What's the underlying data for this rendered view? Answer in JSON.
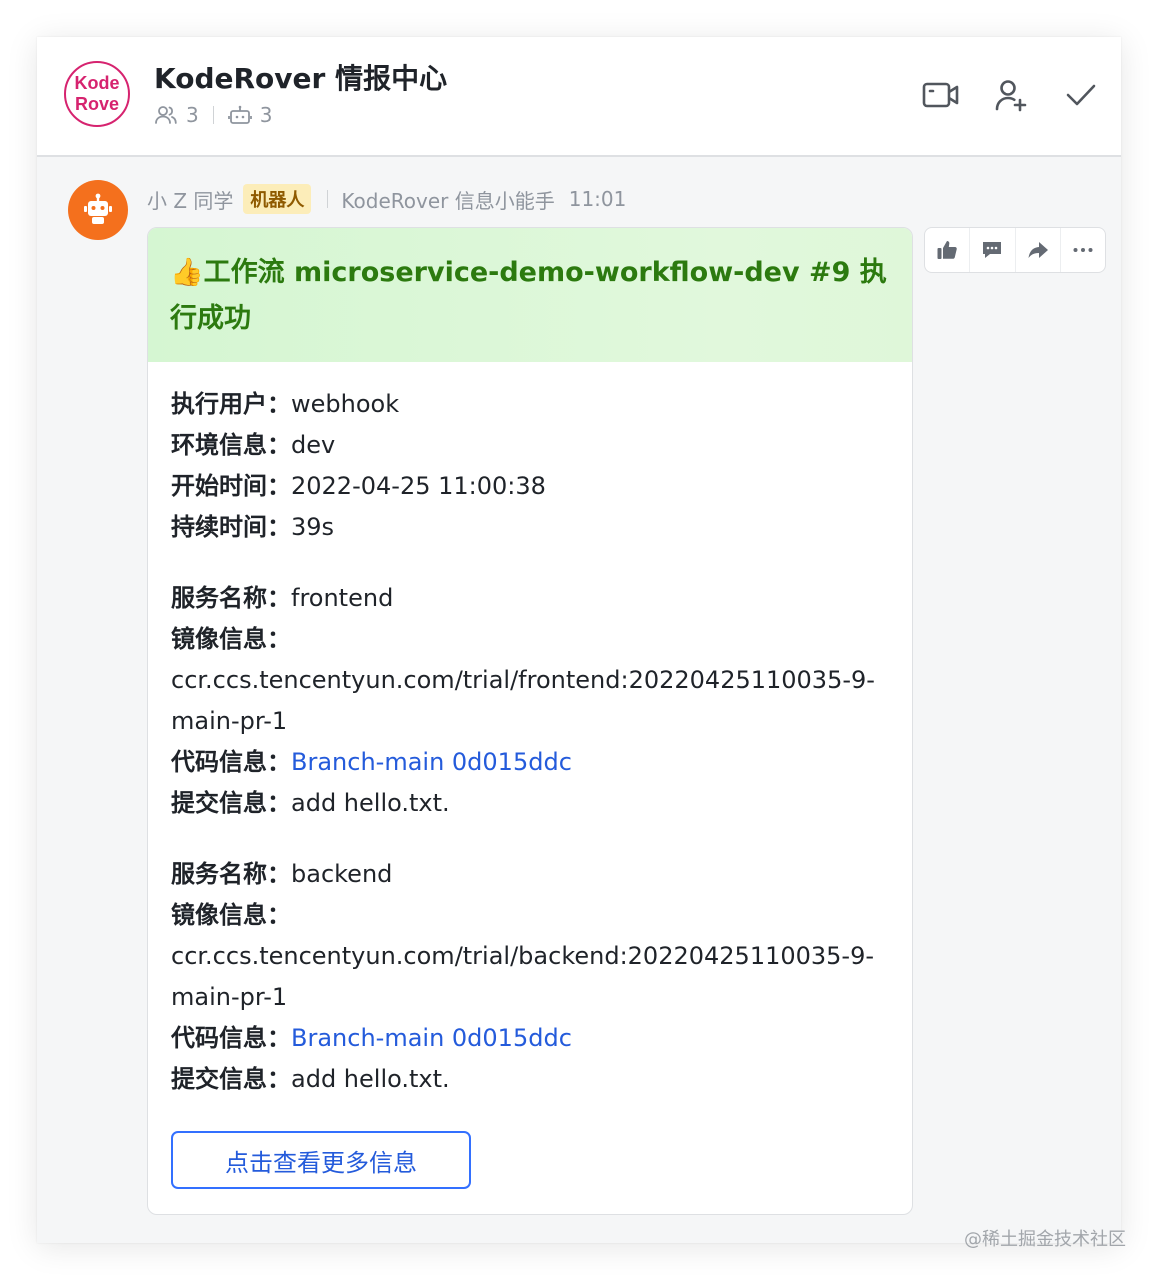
{
  "header": {
    "avatar_line1": "Kode",
    "avatar_line2": "Rove",
    "title": "KodeRover 情报中心",
    "member_count": "3",
    "bot_count": "3",
    "actions": [
      {
        "name": "video-call-icon"
      },
      {
        "name": "add-member-icon"
      },
      {
        "name": "checkmark-icon"
      }
    ]
  },
  "message": {
    "sender": "小 Z 同学",
    "badge": "机器人",
    "bot_name": "KodeRover 信息小能手",
    "time": "11:01",
    "avatar_icon": "robot-icon"
  },
  "card": {
    "title": "👍工作流 microservice-demo-workflow-dev #9 执行成功",
    "header_color": "#d5f6d2",
    "title_color": "#2c7a0f",
    "link_color": "#245bdb",
    "summary": [
      {
        "label": "执行用户：",
        "value": "webhook"
      },
      {
        "label": "环境信息：",
        "value": "dev"
      },
      {
        "label": "开始时间：",
        "value": "2022-04-25 11:00:38"
      },
      {
        "label": "持续时间：",
        "value": "39s"
      }
    ],
    "services": [
      {
        "name_label": "服务名称：",
        "name_value": "frontend",
        "image_label": "镜像信息：",
        "image_value": "ccr.ccs.tencentyun.com/trial/frontend:20220425110035-9-main-pr-1",
        "code_label": "代码信息：",
        "code_value": "Branch-main 0d015ddc",
        "commit_label": "提交信息：",
        "commit_value": "add hello.txt."
      },
      {
        "name_label": "服务名称：",
        "name_value": "backend",
        "image_label": "镜像信息：",
        "image_value": "ccr.ccs.tencentyun.com/trial/backend:20220425110035-9-main-pr-1",
        "code_label": "代码信息：",
        "code_value": "Branch-main 0d015ddc",
        "commit_label": "提交信息：",
        "commit_value": "add hello.txt."
      }
    ],
    "more_button": "点击查看更多信息"
  },
  "toolbar": [
    {
      "name": "thumbs-up-icon"
    },
    {
      "name": "reply-comment-icon"
    },
    {
      "name": "forward-icon"
    },
    {
      "name": "more-icon"
    }
  ],
  "watermark": "@稀土掘金技术社区"
}
